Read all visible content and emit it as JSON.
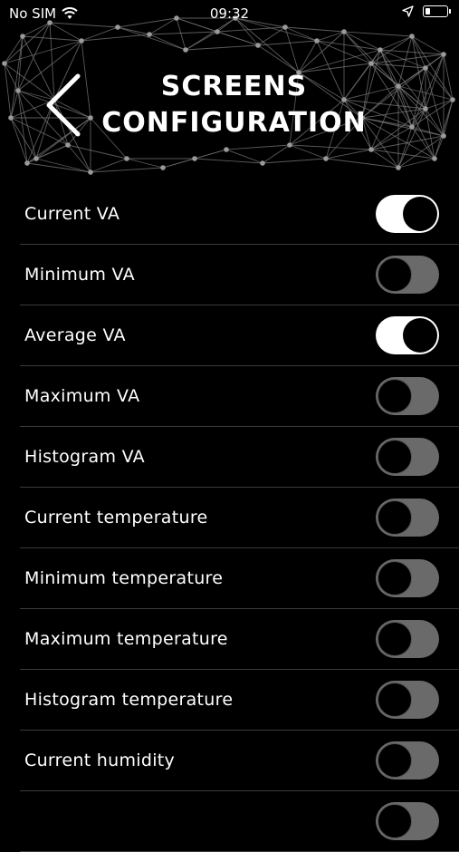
{
  "status_bar": {
    "carrier": "No SIM",
    "time": "09:32",
    "icons": [
      "wifi-icon",
      "location-arrow-icon",
      "battery-icon"
    ]
  },
  "header": {
    "title_line1": "SCREENS",
    "title_line2": "CONFIGURATION",
    "back_icon": "chevron-left-icon"
  },
  "settings": [
    {
      "label": "Current VA",
      "enabled": true
    },
    {
      "label": "Minimum VA",
      "enabled": false
    },
    {
      "label": "Average VA",
      "enabled": true
    },
    {
      "label": "Maximum VA",
      "enabled": false
    },
    {
      "label": "Histogram VA",
      "enabled": false
    },
    {
      "label": "Current temperature",
      "enabled": false
    },
    {
      "label": "Minimum temperature",
      "enabled": false
    },
    {
      "label": "Maximum temperature",
      "enabled": false
    },
    {
      "label": "Histogram temperature",
      "enabled": false
    },
    {
      "label": "Current humidity",
      "enabled": false
    },
    {
      "label": "",
      "enabled": false
    }
  ],
  "colors": {
    "background": "#000000",
    "toggle_on": "#ffffff",
    "toggle_off": "#6a6a6a",
    "divider": "#3b3b3b"
  }
}
